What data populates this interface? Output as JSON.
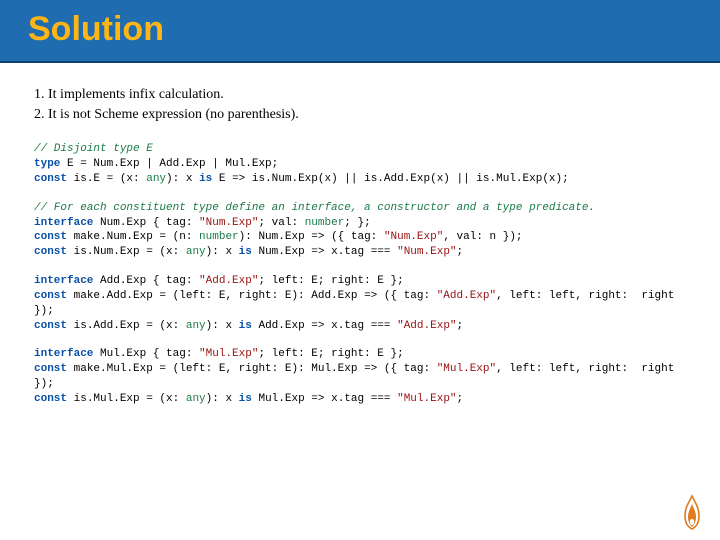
{
  "header": {
    "title": "Solution"
  },
  "rules": {
    "r1": "1. It implements infix calculation.",
    "r2": "2. It is not Scheme expression (no parenthesis)."
  },
  "code": {
    "b1_cm": "// Disjoint type E",
    "b1_l1a": "type",
    "b1_l1b": " E = Num.Exp | Add.Exp | Mul.Exp;",
    "b1_l2a": "const",
    "b1_l2b": " is.E = (x: ",
    "b1_l2c": "any",
    "b1_l2d": "): x ",
    "b1_l2e": "is",
    "b1_l2f": " E => is.Num.Exp(x) || is.Add.Exp(x) || is.Mul.Exp(x);",
    "b2_cm": "// For each constituent type define an interface, a constructor and a type predicate.",
    "b2_l1a": "interface",
    "b2_l1b": " Num.Exp { tag: ",
    "b2_l1c": "\"Num.Exp\"",
    "b2_l1d": "; val: ",
    "b2_l1e": "number",
    "b2_l1f": "; };",
    "b2_l2a": "const",
    "b2_l2b": " make.Num.Exp = (n: ",
    "b2_l2c": "number",
    "b2_l2d": "): Num.Exp => ({ tag: ",
    "b2_l2e": "\"Num.Exp\"",
    "b2_l2f": ", val: n });",
    "b2_l3a": "const",
    "b2_l3b": " is.Num.Exp = (x: ",
    "b2_l3c": "any",
    "b2_l3d": "): x ",
    "b2_l3e": "is",
    "b2_l3f": " Num.Exp => x.tag === ",
    "b2_l3g": "\"Num.Exp\"",
    "b2_l3h": ";",
    "b3_l1a": "interface",
    "b3_l1b": " Add.Exp { tag: ",
    "b3_l1c": "\"Add.Exp\"",
    "b3_l1d": "; left: E; right: E };",
    "b3_l2a": "const",
    "b3_l2b": " make.Add.Exp = (left: E, right: E): Add.Exp => ({ tag: ",
    "b3_l2c": "\"Add.Exp\"",
    "b3_l2d": ", left: left, right:  right });",
    "b3_l3a": "const",
    "b3_l3b": " is.Add.Exp = (x: ",
    "b3_l3c": "any",
    "b3_l3d": "): x ",
    "b3_l3e": "is",
    "b3_l3f": " Add.Exp => x.tag === ",
    "b3_l3g": "\"Add.Exp\"",
    "b3_l3h": ";",
    "b4_l1a": "interface",
    "b4_l1b": " Mul.Exp { tag: ",
    "b4_l1c": "\"Mul.Exp\"",
    "b4_l1d": "; left: E; right: E };",
    "b4_l2a": "const",
    "b4_l2b": " make.Mul.Exp = (left: E, right: E): Mul.Exp => ({ tag: ",
    "b4_l2c": "\"Mul.Exp\"",
    "b4_l2d": ", left: left, right:  right });",
    "b4_l3a": "const",
    "b4_l3b": " is.Mul.Exp = (x: ",
    "b4_l3c": "any",
    "b4_l3d": "): x ",
    "b4_l3e": "is",
    "b4_l3f": " Mul.Exp => x.tag === ",
    "b4_l3g": "\"Mul.Exp\"",
    "b4_l3h": ";"
  }
}
